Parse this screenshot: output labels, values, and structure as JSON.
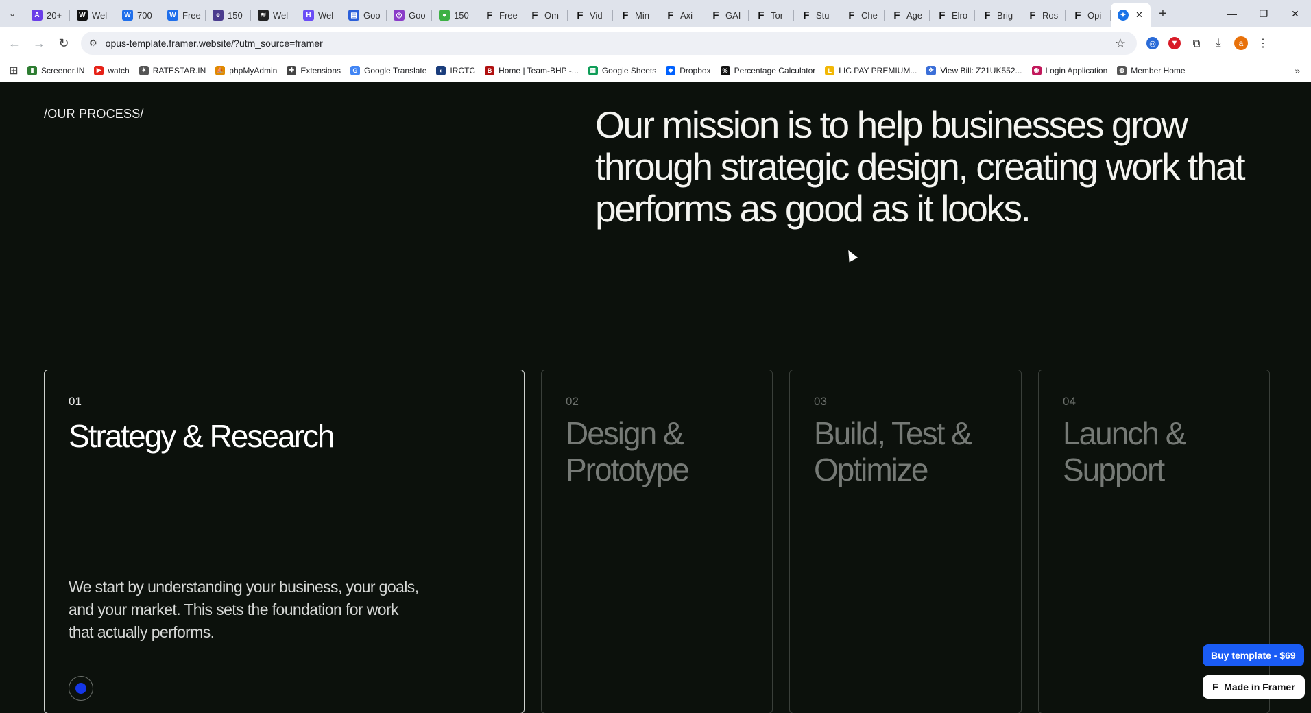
{
  "browser": {
    "tabs": [
      {
        "label": "20+",
        "icon": "A",
        "color": "#6a3de8"
      },
      {
        "label": "Wel",
        "icon": "W",
        "color": "#111111"
      },
      {
        "label": "700",
        "icon": "W",
        "color": "#1f6feb"
      },
      {
        "label": "Free",
        "icon": "W",
        "color": "#1f6feb"
      },
      {
        "label": "150",
        "icon": "e",
        "color": "#4b3c8e"
      },
      {
        "label": "Wel",
        "icon": "≋",
        "color": "#222222"
      },
      {
        "label": "Wel",
        "icon": "H",
        "color": "#6b4cf6"
      },
      {
        "label": "Goo",
        "icon": "▤",
        "color": "#2b5fd9"
      },
      {
        "label": "Goo",
        "icon": "◎",
        "color": "#8a3cc8"
      },
      {
        "label": "150",
        "icon": "●",
        "color": "#3cb043"
      },
      {
        "label": "Free",
        "icon": "F",
        "color": "framer"
      },
      {
        "label": "Om",
        "icon": "F",
        "color": "framer"
      },
      {
        "label": "Vid",
        "icon": "F",
        "color": "framer"
      },
      {
        "label": "Min",
        "icon": "F",
        "color": "framer"
      },
      {
        "label": "Axi",
        "icon": "F",
        "color": "framer"
      },
      {
        "label": "GAI",
        "icon": "F",
        "color": "framer"
      },
      {
        "label": "Tor",
        "icon": "F",
        "color": "framer"
      },
      {
        "label": "Stu",
        "icon": "F",
        "color": "framer"
      },
      {
        "label": "Che",
        "icon": "F",
        "color": "framer"
      },
      {
        "label": "Age",
        "icon": "F",
        "color": "framer"
      },
      {
        "label": "Elro",
        "icon": "F",
        "color": "framer"
      },
      {
        "label": "Brig",
        "icon": "F",
        "color": "framer"
      },
      {
        "label": "Ros",
        "icon": "F",
        "color": "framer"
      },
      {
        "label": "Opi",
        "icon": "F",
        "color": "framer"
      }
    ],
    "active_tab": {
      "icon": "✦",
      "color": "#1a73e8"
    },
    "url": "opus-template.framer.website/?utm_source=framer",
    "bookmarks": [
      {
        "label": "Screener.IN",
        "icon": "▮",
        "color": "#2e7d32"
      },
      {
        "label": "watch",
        "icon": "▶",
        "color": "#e62117"
      },
      {
        "label": "RATESTAR.IN",
        "icon": "✶",
        "color": "#555555"
      },
      {
        "label": "phpMyAdmin",
        "icon": "⛵",
        "color": "#e08a00"
      },
      {
        "label": "Extensions",
        "icon": "✚",
        "color": "#444444"
      },
      {
        "label": "Google Translate",
        "icon": "G",
        "color": "#4285f4"
      },
      {
        "label": "IRCTC",
        "icon": "◐",
        "color": "#1a3d7c"
      },
      {
        "label": "Home | Team-BHP -...",
        "icon": "B",
        "color": "#b01010"
      },
      {
        "label": "Google Sheets",
        "icon": "▦",
        "color": "#0f9d58"
      },
      {
        "label": "Dropbox",
        "icon": "◆",
        "color": "#0061fe"
      },
      {
        "label": "Percentage Calculator",
        "icon": "%",
        "color": "#111111"
      },
      {
        "label": "LIC PAY PREMIUM...",
        "icon": "L",
        "color": "#f2b705"
      },
      {
        "label": "View Bill: Z21UK552...",
        "icon": "✈",
        "color": "#3b6fd8"
      },
      {
        "label": "Login Application",
        "icon": "◉",
        "color": "#c2185b"
      },
      {
        "label": "Member Home",
        "icon": "◍",
        "color": "#555555"
      }
    ]
  },
  "page": {
    "section_label": "/OUR PROCESS/",
    "mission": "Our mission is to help businesses grow through strategic design, creating work that performs as good as it looks.",
    "steps": [
      {
        "num": "01",
        "title": "Strategy & Research",
        "desc": "We start by understanding your business, your goals, and your market. This sets the foundation for work that actually performs.",
        "active": true
      },
      {
        "num": "02",
        "title": "Design & Prototype",
        "active": false
      },
      {
        "num": "03",
        "title": "Build, Test & Optimize",
        "active": false
      },
      {
        "num": "04",
        "title": "Launch & Support",
        "active": false
      }
    ],
    "buy_button": "Buy template - $69",
    "made_in": "Made in Framer"
  }
}
